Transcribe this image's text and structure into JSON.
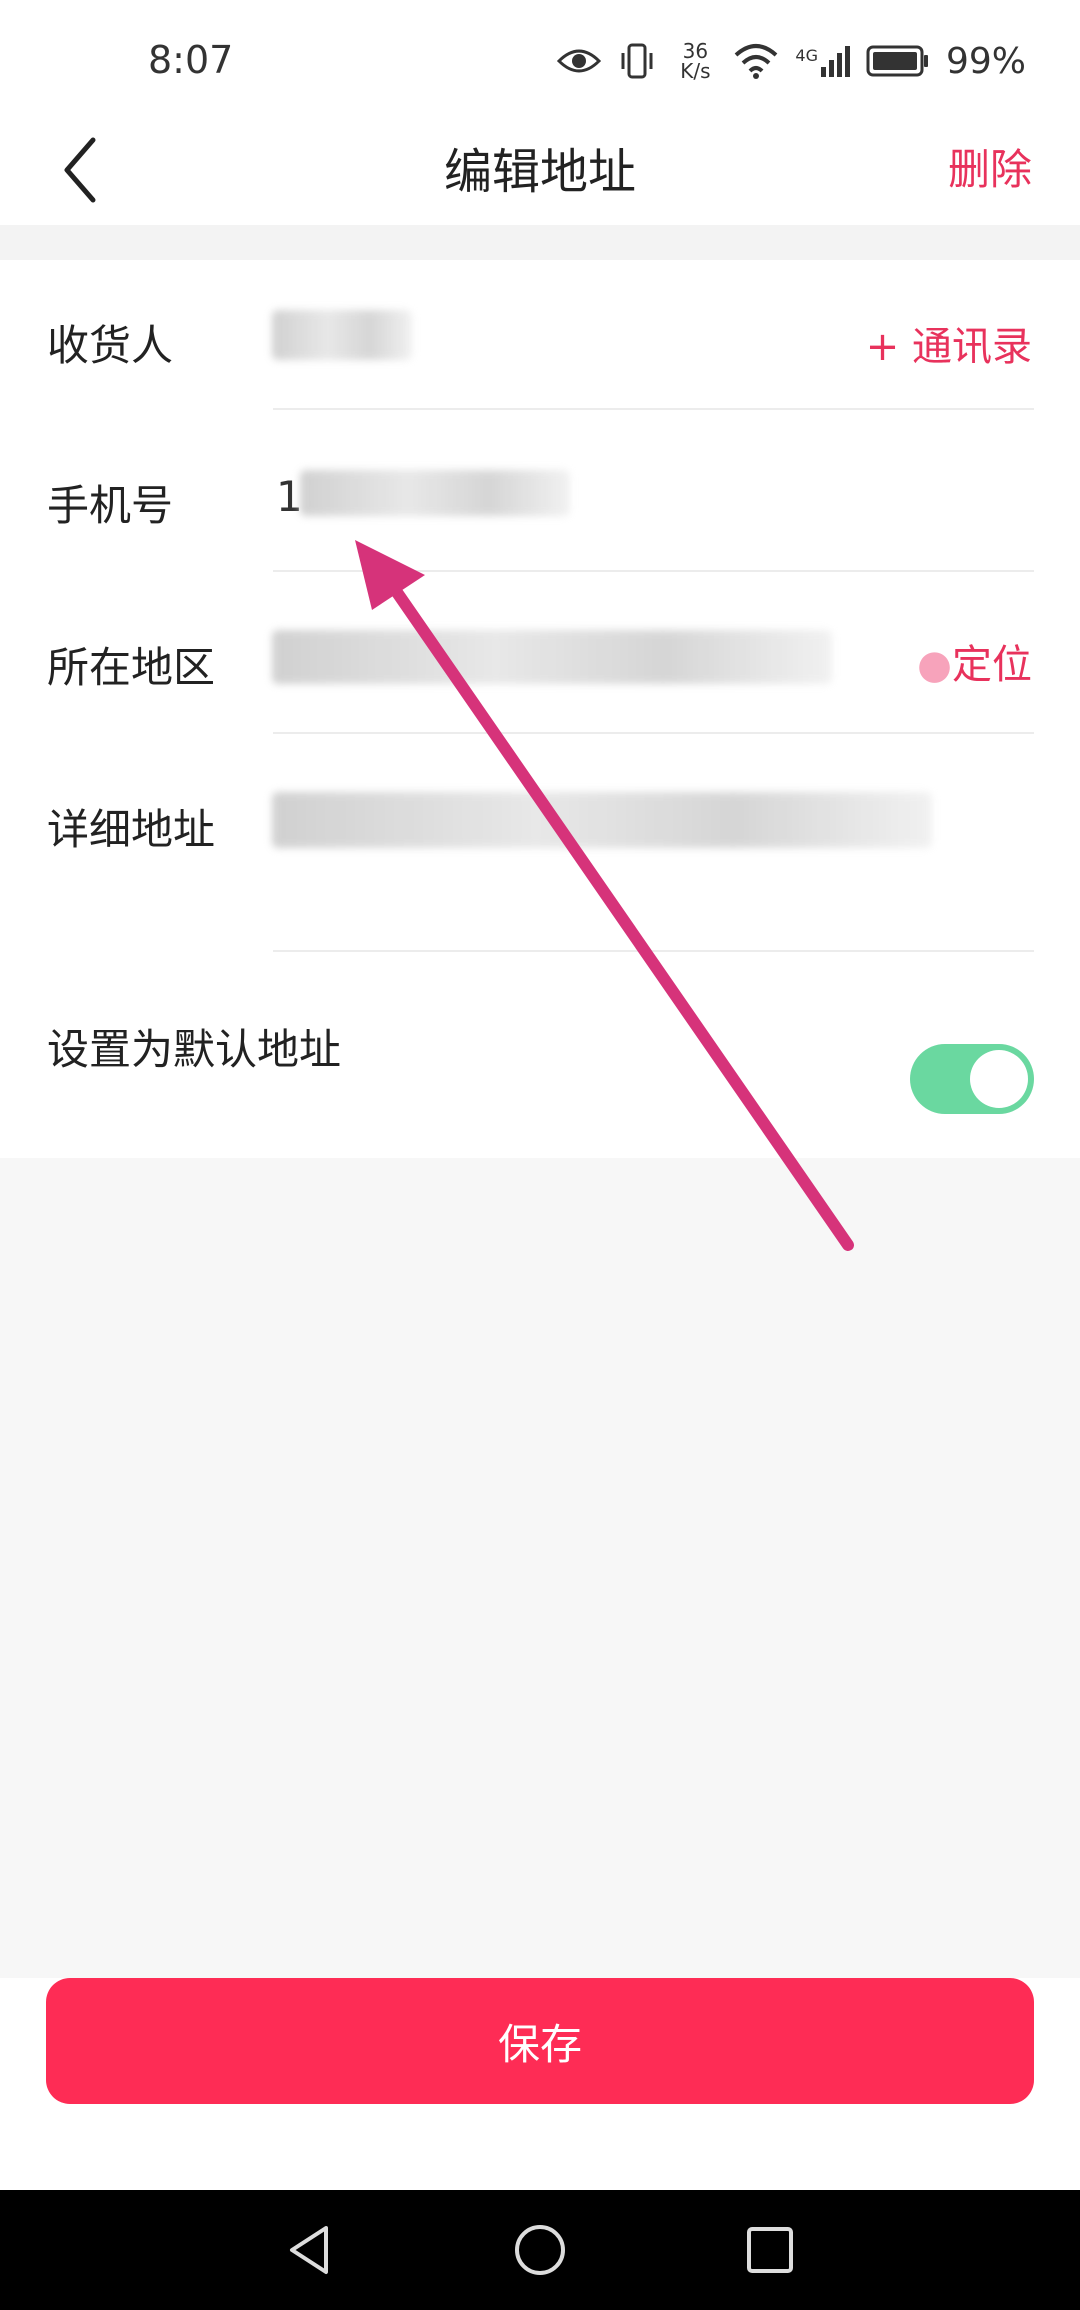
{
  "status_bar": {
    "time": "8:07",
    "net_speed_value": "36",
    "net_speed_unit": "K/s",
    "network_type": "4G",
    "battery_percent": "99%"
  },
  "header": {
    "title": "编辑地址",
    "delete_label": "删除"
  },
  "form": {
    "recipient": {
      "label": "收货人",
      "contacts_label": "+ 通讯录"
    },
    "phone": {
      "label": "手机号",
      "value_visible": "1"
    },
    "region": {
      "label": "所在地区",
      "locate_label": "定位"
    },
    "detail": {
      "label": "详细地址"
    },
    "default_address": {
      "label": "设置为默认地址",
      "enabled": true
    }
  },
  "footer": {
    "save_label": "保存"
  },
  "colors": {
    "accent": "#e8325c",
    "save_button": "#fe2c55",
    "toggle_on": "#6ad8a0",
    "annotation_arrow": "#d6337a"
  },
  "icons": [
    "back-chevron-icon",
    "eye-icon",
    "vibrate-icon",
    "wifi-icon",
    "signal-icon",
    "battery-icon",
    "nav-back-icon",
    "nav-home-icon",
    "nav-recents-icon"
  ]
}
